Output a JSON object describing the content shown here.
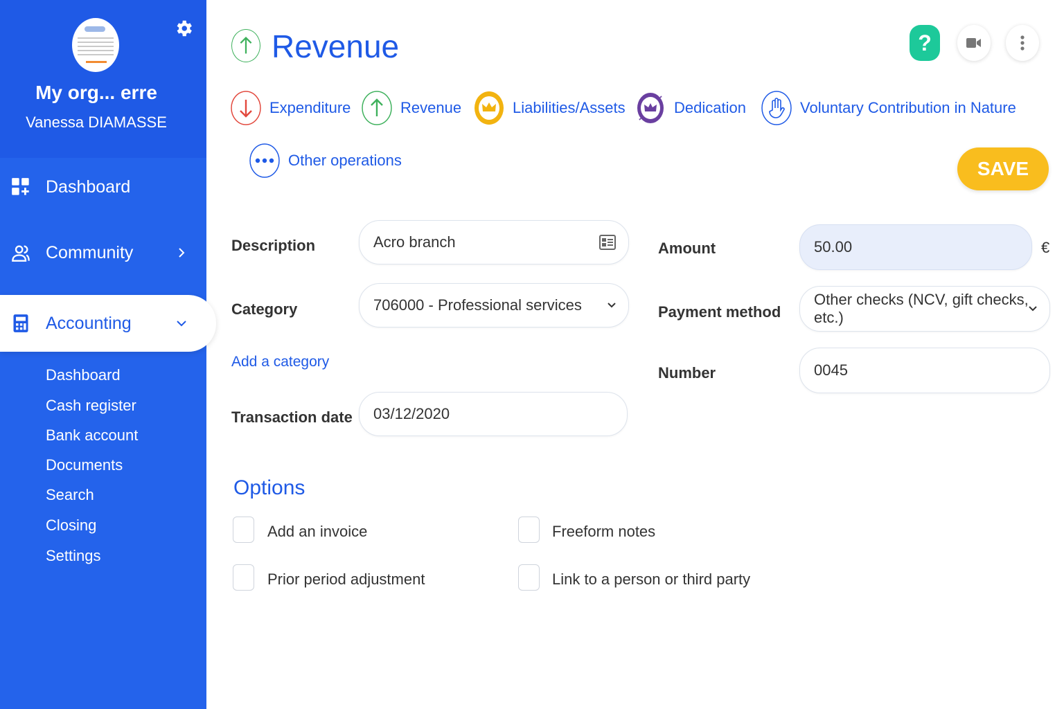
{
  "sidebar": {
    "org_name": "My org... erre",
    "user_name": "Vanessa DIAMASSE",
    "nav": {
      "dashboard": "Dashboard",
      "community": "Community",
      "accounting": "Accounting"
    },
    "sub_items": [
      "Dashboard",
      "Cash register",
      "Bank account",
      "Documents",
      "Search",
      "Closing",
      "Settings"
    ],
    "colors": {
      "background": "#2463eb",
      "header": "#1f5ae6"
    }
  },
  "header": {
    "title": "Revenue",
    "buttons": {
      "help": "?",
      "video": "video-icon",
      "more": "more-vertical-icon"
    }
  },
  "operations": {
    "expenditure": "Expenditure",
    "revenue": "Revenue",
    "liabilities": "Liabilities/Assets",
    "dedication": "Dedication",
    "voluntary": "Voluntary Contribution in Nature",
    "other": "Other operations"
  },
  "actions": {
    "save": "SAVE"
  },
  "form": {
    "description": {
      "label": "Description",
      "value": "Acro branch"
    },
    "category": {
      "label": "Category",
      "value": "706000 - Professional services"
    },
    "add_category": "Add a category",
    "transaction_date": {
      "label": "Transaction date",
      "value": "03/12/2020"
    },
    "amount": {
      "label": "Amount",
      "value": "50.00",
      "currency": "€"
    },
    "payment_method": {
      "label": "Payment method",
      "value": "Other checks (NCV, gift checks, etc.)"
    },
    "number": {
      "label": "Number",
      "value": "0045"
    }
  },
  "options": {
    "title": "Options",
    "items": {
      "invoice": "Add an invoice",
      "notes": "Freeform notes",
      "prior": "Prior period adjustment",
      "link": "Link to a person or third party"
    }
  },
  "colors": {
    "accent": "#1f5ae6",
    "save": "#f9bd1e",
    "help": "#1dc99a",
    "expenditure": "#e2483d",
    "revenue": "#3fb15d",
    "liabilities": "#f2b310",
    "dedication": "#6a3fa0"
  }
}
